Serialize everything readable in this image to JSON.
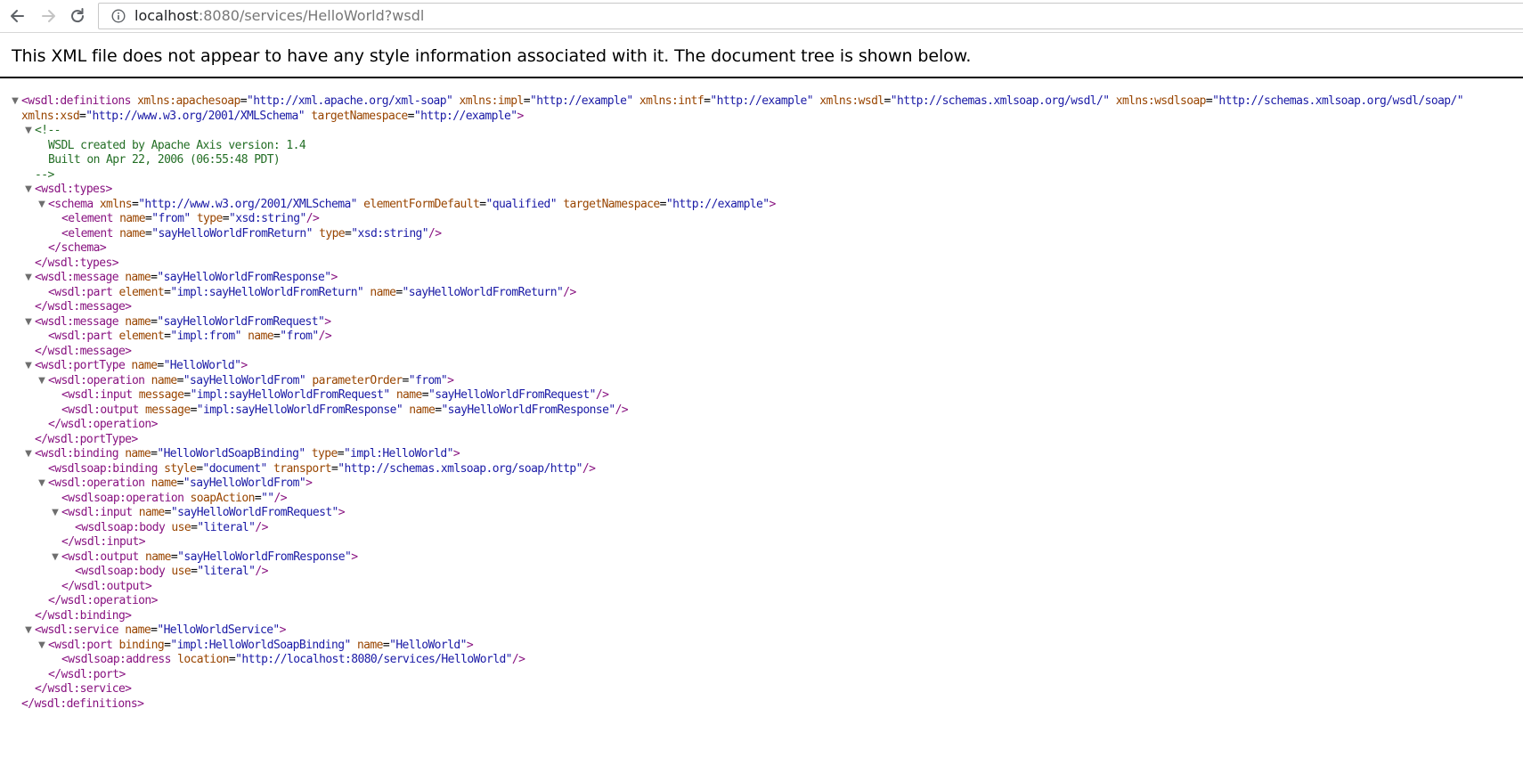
{
  "browser": {
    "url_host": "localhost",
    "url_path": ":8080/services/HelloWorld?wsdl"
  },
  "banner": "This XML file does not appear to have any style information associated with it. The document tree is shown below.",
  "tree": {
    "l0": {
      "pre": "<wsdl:definitions",
      "attrs": [
        {
          "n": "xmlns:apachesoap",
          "v": "\"http://xml.apache.org/xml-soap\""
        },
        {
          "n": "xmlns:impl",
          "v": "\"http://example\""
        },
        {
          "n": "xmlns:intf",
          "v": "\"http://example\""
        },
        {
          "n": "xmlns:wsdl",
          "v": "\"http://schemas.xmlsoap.org/wsdl/\""
        },
        {
          "n": "xmlns:wsdlsoap",
          "v": "\"http://schemas.xmlsoap.org/wsdl/soap/\""
        }
      ]
    },
    "l1": {
      "attrs": [
        {
          "n": "xmlns:xsd",
          "v": "\"http://www.w3.org/2001/XMLSchema\""
        },
        {
          "n": "targetNamespace",
          "v": "\"http://example\""
        }
      ],
      "post": ">"
    },
    "c0": "<!--",
    "c1": "WSDL created by Apache Axis version: 1.4",
    "c2": "Built on Apr 22, 2006 (06:55:48 PDT)",
    "c3": "-->",
    "l2": {
      "pre": "<wsdl:types>"
    },
    "l3": {
      "pre": "<schema",
      "attrs": [
        {
          "n": "xmlns",
          "v": "\"http://www.w3.org/2001/XMLSchema\""
        },
        {
          "n": "elementFormDefault",
          "v": "\"qualified\""
        },
        {
          "n": "targetNamespace",
          "v": "\"http://example\""
        }
      ],
      "post": ">"
    },
    "l4": {
      "pre": "<element",
      "attrs": [
        {
          "n": "name",
          "v": "\"from\""
        },
        {
          "n": "type",
          "v": "\"xsd:string\""
        }
      ],
      "post": "/>"
    },
    "l5": {
      "pre": "<element",
      "attrs": [
        {
          "n": "name",
          "v": "\"sayHelloWorldFromReturn\""
        },
        {
          "n": "type",
          "v": "\"xsd:string\""
        }
      ],
      "post": "/>"
    },
    "l6": {
      "pre": "</schema>"
    },
    "l7": {
      "pre": "</wsdl:types>"
    },
    "l8": {
      "pre": "<wsdl:message",
      "attrs": [
        {
          "n": "name",
          "v": "\"sayHelloWorldFromResponse\""
        }
      ],
      "post": ">"
    },
    "l9": {
      "pre": "<wsdl:part",
      "attrs": [
        {
          "n": "element",
          "v": "\"impl:sayHelloWorldFromReturn\""
        },
        {
          "n": "name",
          "v": "\"sayHelloWorldFromReturn\""
        }
      ],
      "post": "/>"
    },
    "l10": {
      "pre": "</wsdl:message>"
    },
    "l11": {
      "pre": "<wsdl:message",
      "attrs": [
        {
          "n": "name",
          "v": "\"sayHelloWorldFromRequest\""
        }
      ],
      "post": ">"
    },
    "l12": {
      "pre": "<wsdl:part",
      "attrs": [
        {
          "n": "element",
          "v": "\"impl:from\""
        },
        {
          "n": "name",
          "v": "\"from\""
        }
      ],
      "post": "/>"
    },
    "l13": {
      "pre": "</wsdl:message>"
    },
    "l14": {
      "pre": "<wsdl:portType",
      "attrs": [
        {
          "n": "name",
          "v": "\"HelloWorld\""
        }
      ],
      "post": ">"
    },
    "l15": {
      "pre": "<wsdl:operation",
      "attrs": [
        {
          "n": "name",
          "v": "\"sayHelloWorldFrom\""
        },
        {
          "n": "parameterOrder",
          "v": "\"from\""
        }
      ],
      "post": ">"
    },
    "l16": {
      "pre": "<wsdl:input",
      "attrs": [
        {
          "n": "message",
          "v": "\"impl:sayHelloWorldFromRequest\""
        },
        {
          "n": "name",
          "v": "\"sayHelloWorldFromRequest\""
        }
      ],
      "post": "/>"
    },
    "l17": {
      "pre": "<wsdl:output",
      "attrs": [
        {
          "n": "message",
          "v": "\"impl:sayHelloWorldFromResponse\""
        },
        {
          "n": "name",
          "v": "\"sayHelloWorldFromResponse\""
        }
      ],
      "post": "/>"
    },
    "l18": {
      "pre": "</wsdl:operation>"
    },
    "l19": {
      "pre": "</wsdl:portType>"
    },
    "l20": {
      "pre": "<wsdl:binding",
      "attrs": [
        {
          "n": "name",
          "v": "\"HelloWorldSoapBinding\""
        },
        {
          "n": "type",
          "v": "\"impl:HelloWorld\""
        }
      ],
      "post": ">"
    },
    "l21": {
      "pre": "<wsdlsoap:binding",
      "attrs": [
        {
          "n": "style",
          "v": "\"document\""
        },
        {
          "n": "transport",
          "v": "\"http://schemas.xmlsoap.org/soap/http\""
        }
      ],
      "post": "/>"
    },
    "l22": {
      "pre": "<wsdl:operation",
      "attrs": [
        {
          "n": "name",
          "v": "\"sayHelloWorldFrom\""
        }
      ],
      "post": ">"
    },
    "l23": {
      "pre": "<wsdlsoap:operation",
      "attrs": [
        {
          "n": "soapAction",
          "v": "\"\""
        }
      ],
      "post": "/>"
    },
    "l24": {
      "pre": "<wsdl:input",
      "attrs": [
        {
          "n": "name",
          "v": "\"sayHelloWorldFromRequest\""
        }
      ],
      "post": ">"
    },
    "l25": {
      "pre": "<wsdlsoap:body",
      "attrs": [
        {
          "n": "use",
          "v": "\"literal\""
        }
      ],
      "post": "/>"
    },
    "l26": {
      "pre": "</wsdl:input>"
    },
    "l27": {
      "pre": "<wsdl:output",
      "attrs": [
        {
          "n": "name",
          "v": "\"sayHelloWorldFromResponse\""
        }
      ],
      "post": ">"
    },
    "l28": {
      "pre": "<wsdlsoap:body",
      "attrs": [
        {
          "n": "use",
          "v": "\"literal\""
        }
      ],
      "post": "/>"
    },
    "l29": {
      "pre": "</wsdl:output>"
    },
    "l30": {
      "pre": "</wsdl:operation>"
    },
    "l31": {
      "pre": "</wsdl:binding>"
    },
    "l32": {
      "pre": "<wsdl:service",
      "attrs": [
        {
          "n": "name",
          "v": "\"HelloWorldService\""
        }
      ],
      "post": ">"
    },
    "l33": {
      "pre": "<wsdl:port",
      "attrs": [
        {
          "n": "binding",
          "v": "\"impl:HelloWorldSoapBinding\""
        },
        {
          "n": "name",
          "v": "\"HelloWorld\""
        }
      ],
      "post": ">"
    },
    "l34": {
      "pre": "<wsdlsoap:address",
      "attrs": [
        {
          "n": "location",
          "v": "\"http://localhost:8080/services/HelloWorld\""
        }
      ],
      "post": "/>"
    },
    "l35": {
      "pre": "</wsdl:port>"
    },
    "l36": {
      "pre": "</wsdl:service>"
    },
    "l37": {
      "pre": "</wsdl:definitions>"
    }
  },
  "colors": {
    "tag": "#881280",
    "attr_name": "#994500",
    "attr_value": "#1a1aa6",
    "comment": "#236e25",
    "triangle": "#6e6e6e"
  },
  "icons": [
    "back-arrow-icon",
    "forward-arrow-icon",
    "reload-icon",
    "info-icon",
    "expand-triangle-icon"
  ]
}
